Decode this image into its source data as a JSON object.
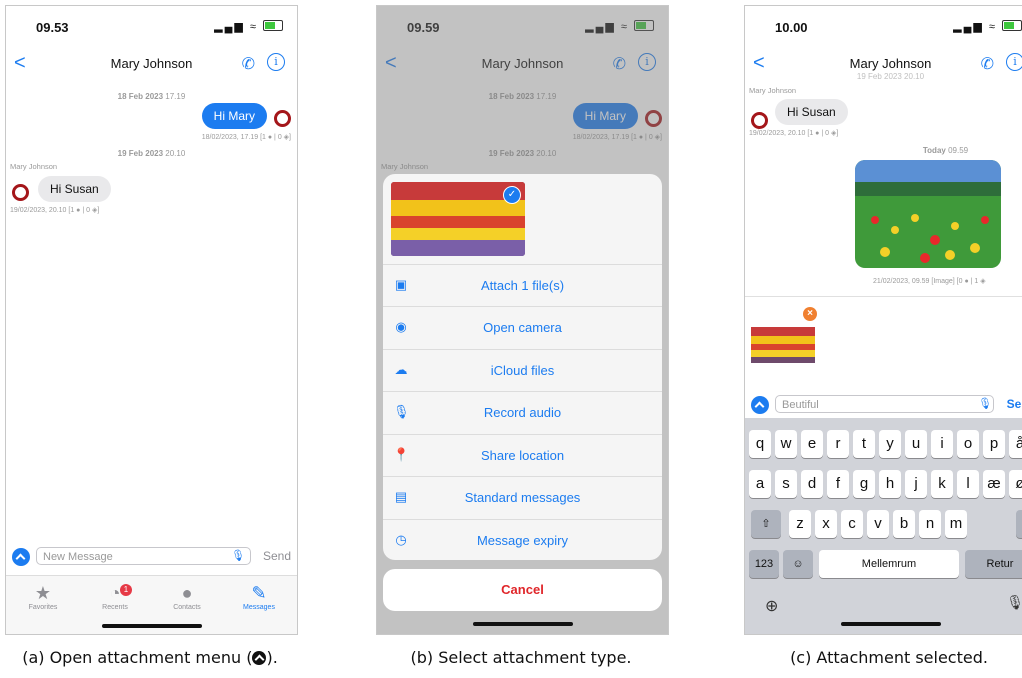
{
  "panel1": {
    "time": "09.53",
    "contact_name": "Mary Johnson",
    "date1": {
      "day": "18 Feb 2023",
      "time": "17.19"
    },
    "msg_out": "Hi Mary",
    "msg_out_meta": "18/02/2023, 17.19  [1 ● | 0 ◈]",
    "date2": {
      "day": "19 Feb 2023",
      "time": "20.10"
    },
    "sender": "Mary Johnson",
    "msg_in": "Hi Susan",
    "msg_in_meta": "19/02/2023, 20.10  [1 ● | 0 ◈]",
    "composer_placeholder": "New Message",
    "send_label": "Send",
    "tabs": [
      {
        "label": "Favorites",
        "icon": "star-icon"
      },
      {
        "label": "Recents",
        "icon": "clock-icon",
        "badge": "1"
      },
      {
        "label": "Contacts",
        "icon": "person-icon"
      },
      {
        "label": "Messages",
        "icon": "compose-icon"
      }
    ]
  },
  "panel2": {
    "time": "09.59",
    "contact_name": "Mary Johnson",
    "date1": {
      "day": "18 Feb 2023",
      "time": "17.19"
    },
    "msg_out": "Hi Mary",
    "msg_out_meta": "18/02/2023, 17.19  [1 ● | 0 ◈]",
    "date2": {
      "day": "19 Feb 2023",
      "time": "20.10"
    },
    "sender": "Mary Johnson",
    "options": [
      {
        "label": "Attach 1 file(s)",
        "icon": "image-icon"
      },
      {
        "label": "Open camera",
        "icon": "camera-icon"
      },
      {
        "label": "iCloud files",
        "icon": "cloud-icon"
      },
      {
        "label": "Record audio",
        "icon": "mic-icon"
      },
      {
        "label": "Share location",
        "icon": "pin-icon"
      },
      {
        "label": "Standard messages",
        "icon": "document-icon"
      },
      {
        "label": "Message expiry",
        "icon": "clock-icon"
      }
    ],
    "cancel_label": "Cancel"
  },
  "panel3": {
    "time": "10.00",
    "contact_name": "Mary Johnson",
    "top_date": "19 Feb 2023 20.10",
    "sender": "Mary Johnson",
    "msg_in": "Hi Susan",
    "msg_in_meta": "19/02/2023, 20.10  [1 ● | 0 ◈]",
    "today_label": {
      "day": "Today",
      "time": "09.59"
    },
    "image_meta": "21/02/2023, 09.59 [Image]  [0 ● | 1 ◈",
    "composer_value": "Beutiful",
    "send_label": "Send",
    "keyboard": {
      "row1": [
        "q",
        "w",
        "e",
        "r",
        "t",
        "y",
        "u",
        "i",
        "o",
        "p",
        "å"
      ],
      "row2": [
        "a",
        "s",
        "d",
        "f",
        "g",
        "h",
        "j",
        "k",
        "l",
        "æ",
        "ø"
      ],
      "row3": [
        "z",
        "x",
        "c",
        "v",
        "b",
        "n",
        "m"
      ],
      "numbers_key": "123",
      "space_key": "Mellemrum",
      "return_key": "Retur"
    }
  },
  "captions": [
    "(a) Open attachment menu (",
    ").",
    "(b) Select attachment type.",
    "(c) Attachment selected."
  ],
  "colors": {
    "accent": "#1c7cf0",
    "danger": "#e0262a",
    "ring": "#a4161a",
    "badge": "#e63946"
  }
}
